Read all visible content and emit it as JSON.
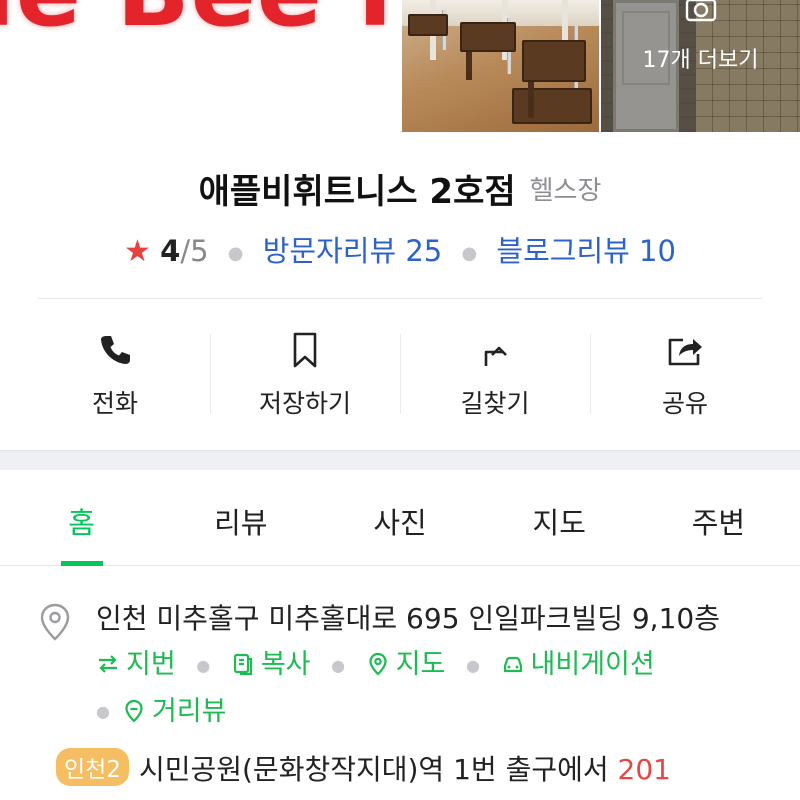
{
  "photos": {
    "sign_text": "le Bee F",
    "more_label": "17개 더보기"
  },
  "place": {
    "name": "애플비휘트니스 2호점",
    "category": "헬스장"
  },
  "rating": {
    "star": "★",
    "value": "4",
    "max": "/5",
    "visitor_reviews": "방문자리뷰 25",
    "blog_reviews": "블로그리뷰 10"
  },
  "actions": [
    {
      "label": "전화",
      "icon": "phone-icon"
    },
    {
      "label": "저장하기",
      "icon": "bookmark-icon"
    },
    {
      "label": "길찾기",
      "icon": "directions-icon"
    },
    {
      "label": "공유",
      "icon": "share-icon"
    }
  ],
  "tabs": [
    "홈",
    "리뷰",
    "사진",
    "지도",
    "주변"
  ],
  "active_tab": "홈",
  "address": {
    "text": "인천 미추홀구 미추홀대로 695 인일파크빌딩 9,10층",
    "lot_label": "지번",
    "copy_label": "복사",
    "map_label": "지도",
    "navi_label": "내비게이션",
    "street_view_label": "거리뷰"
  },
  "subway": {
    "line": "인천2",
    "station": "시민공원(문화창작지대)역",
    "exit": "1번 출구에서",
    "distance": "201"
  },
  "colors": {
    "accent_green": "#03c75a",
    "link_blue": "#2d63c8",
    "star_red": "#e83f3f",
    "distance_red": "#e84545",
    "line_badge": "#f6be62"
  }
}
